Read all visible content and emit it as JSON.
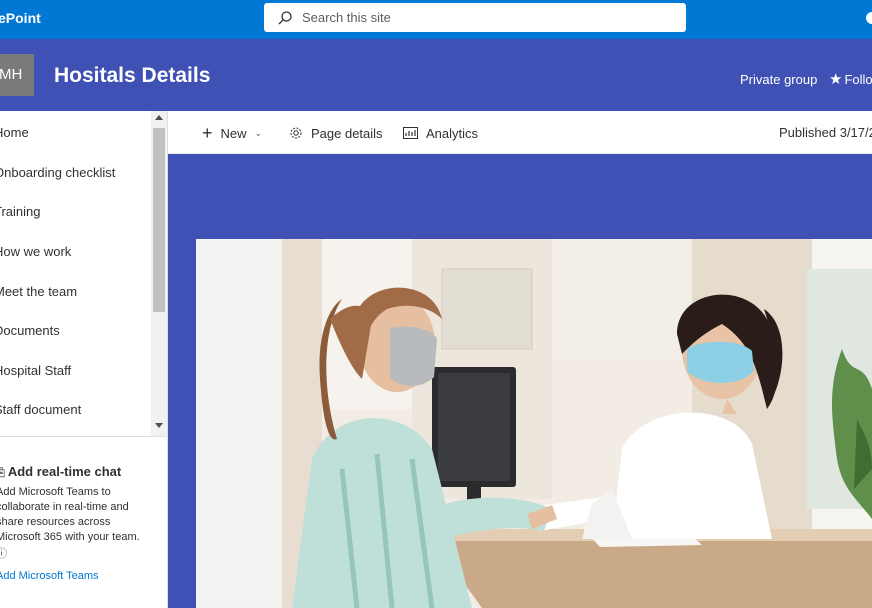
{
  "suite_bar": {
    "app_name": "ePoint",
    "search_placeholder": "Search this site",
    "color": "#0078d4"
  },
  "site_header": {
    "logo_initials": "MH",
    "title": "Hositals Details",
    "group_type": "Private group",
    "follow_label": "Follo",
    "color": "#4051b5"
  },
  "left_nav": {
    "items": [
      {
        "label": "Home"
      },
      {
        "label": "Onboarding checklist"
      },
      {
        "label": "Training"
      },
      {
        "label": "How we work"
      },
      {
        "label": "Meet the team"
      },
      {
        "label": "Documents"
      },
      {
        "label": "Hospital Staff"
      },
      {
        "label": "Staff document"
      }
    ],
    "teams_card": {
      "title": "Add real-time chat",
      "description": "Add Microsoft Teams to collaborate in real-time and share resources across Microsoft 365 with your team.",
      "dots": "ⓘ",
      "link": "Add Microsoft Teams"
    }
  },
  "command_bar": {
    "new_label": "New",
    "page_details_label": "Page details",
    "analytics_label": "Analytics",
    "published": "Published 3/17/2"
  },
  "hero": {
    "image": "photo of two women wearing face masks at a hospital reception desk"
  }
}
